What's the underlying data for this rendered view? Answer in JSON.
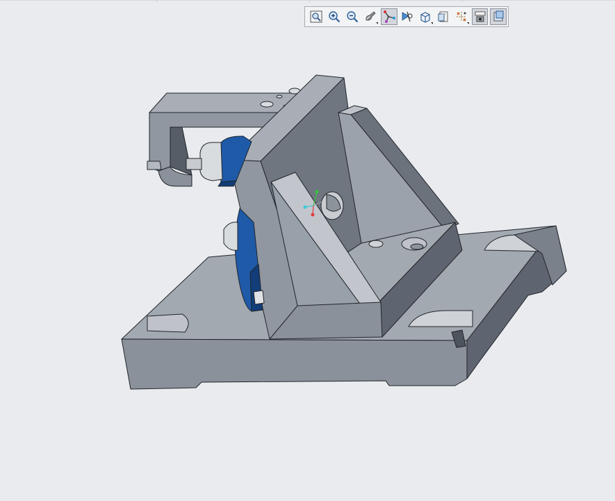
{
  "window": {
    "kind": "3d-cad-viewport"
  },
  "toolbar": {
    "buttons": [
      {
        "id": "refit",
        "icon": "zoom-fit-icon",
        "active": false,
        "flyout": false
      },
      {
        "id": "zoom-in",
        "icon": "zoom-in-icon",
        "active": false,
        "flyout": false
      },
      {
        "id": "zoom-out",
        "icon": "zoom-out-icon",
        "active": false,
        "flyout": false
      },
      {
        "id": "repaint",
        "icon": "repaint-icon",
        "active": false,
        "flyout": true
      },
      {
        "id": "datum-display",
        "icon": "datum-axes-icon",
        "active": true,
        "flyout": false
      },
      {
        "id": "spin-center",
        "icon": "spin-center-icon",
        "active": false,
        "flyout": false
      },
      {
        "id": "display-style",
        "icon": "display-style-cube-icon",
        "active": false,
        "flyout": true
      },
      {
        "id": "saved-views",
        "icon": "saved-views-icon",
        "active": false,
        "flyout": false
      },
      {
        "id": "datum-display-filters",
        "icon": "datum-filters-icon",
        "active": false,
        "flyout": true
      },
      {
        "id": "annotation-display",
        "icon": "annotation-display-icon",
        "active": true,
        "flyout": false
      },
      {
        "id": "appearance",
        "icon": "appearance-icon",
        "active": true,
        "flyout": false
      }
    ]
  },
  "model": {
    "colors": {
      "background": "#e9ebee",
      "steel_light": "#a9aeb6",
      "steel_mid": "#9097a0",
      "steel_dark": "#6b727c",
      "steel_shadow": "#565d67",
      "edge": "#20242a",
      "blue_part": "#1f5aa8",
      "blue_dark": "#123d78",
      "chrome": "#d9dcdf"
    },
    "triad": {
      "x_color": "#e23b3b",
      "y_color": "#35c43a",
      "z_color": "#3fc6d6"
    }
  }
}
